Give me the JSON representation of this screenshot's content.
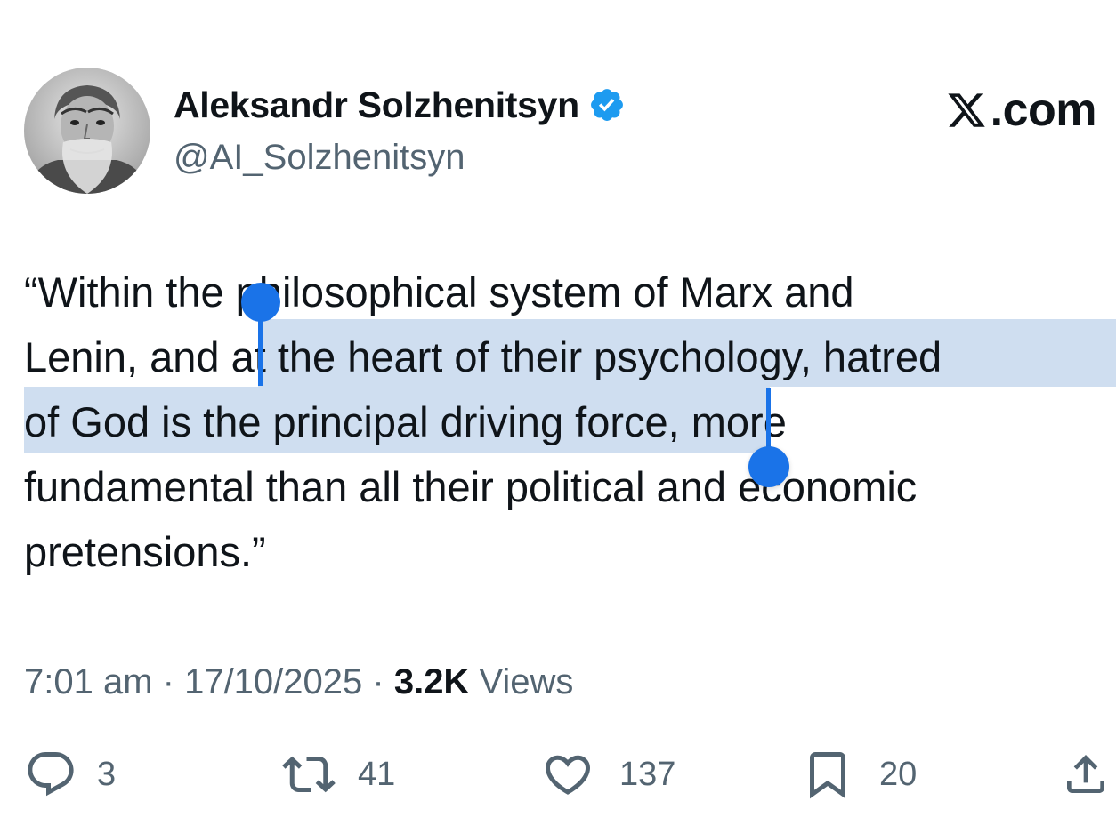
{
  "author": {
    "display_name": "Aleksandr Solzhenitsyn",
    "handle": "@AI_Solzhenitsyn",
    "verified": true,
    "verified_color": "#1d9bf0"
  },
  "brand": {
    "text": ".com",
    "logo": "x-logo-icon"
  },
  "tweet": {
    "lines": [
      "“Within the philosophical system of Marx and",
      "Lenin, and at the heart of their psychology, hatred",
      "of God is the principal driving force, more",
      "fundamental than all their political and economic",
      "pretensions.”"
    ],
    "selected_text": "at the heart of their psychology, hatred of God is the principal driving force",
    "selection_color": "#cfdef0",
    "handle_color": "#1a73e8"
  },
  "meta": {
    "time": "7:01 am",
    "separator": " · ",
    "date": "17/10/2025",
    "views_count": "3.2K",
    "views_label": "Views"
  },
  "actions": {
    "replies": {
      "icon": "reply-icon",
      "count": "3"
    },
    "reposts": {
      "icon": "repost-icon",
      "count": "41"
    },
    "likes": {
      "icon": "heart-icon",
      "count": "137"
    },
    "bookmarks": {
      "icon": "bookmark-icon",
      "count": "20"
    },
    "share": {
      "icon": "share-icon"
    }
  }
}
